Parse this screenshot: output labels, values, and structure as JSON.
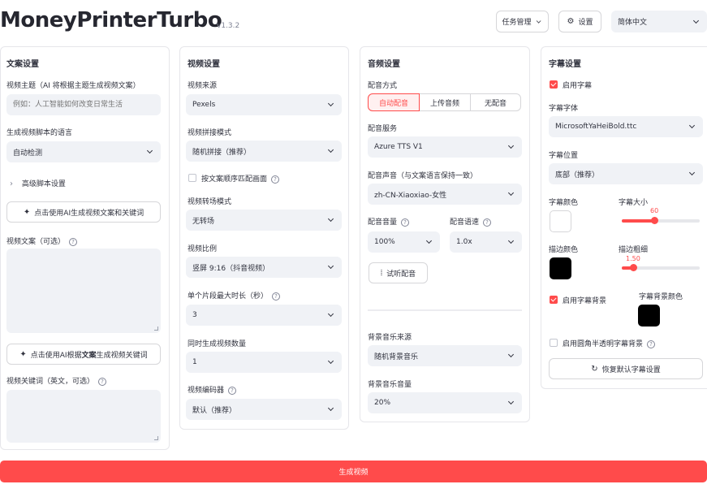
{
  "header": {
    "title": "MoneyPrinterTurbo",
    "version": "v1.3.2",
    "task_mgmt_label": "任务管理",
    "settings_label": "设置",
    "language_value": "简体中文"
  },
  "script_panel": {
    "title": "文案设置",
    "subject_label": "视频主题（AI 将根据主题生成视频文案）",
    "subject_placeholder": "例如：人工智能如何改变日常生活",
    "language_label": "生成视频脚本的语言",
    "language_value": "自动检测",
    "advanced_label": "高级脚本设置",
    "gen_script_btn": "点击使用AI生成视频文案和关键词",
    "script_label": "视频文案（可选）",
    "gen_keywords_btn_pre": "点击使用AI根据",
    "gen_keywords_btn_bold": "文案",
    "gen_keywords_btn_post": "生成视频关键词",
    "keywords_label": "视频关键词（英文，可选）"
  },
  "video_panel": {
    "title": "视频设置",
    "source_label": "视频来源",
    "source_value": "Pexels",
    "concat_label": "视频拼接模式",
    "concat_value": "随机拼接（推荐）",
    "match_label": "按文案顺序匹配画面",
    "transition_label": "视频转场模式",
    "transition_value": "无转场",
    "aspect_label": "视频比例",
    "aspect_value": "竖屏 9:16（抖音视频）",
    "clip_len_label": "单个片段最大时长（秒）",
    "clip_len_value": "3",
    "count_label": "同时生成视频数量",
    "count_value": "1",
    "codec_label": "视频编码器",
    "codec_value": "默认（推荐）"
  },
  "audio_panel": {
    "title": "音频设置",
    "mode_label": "配音方式",
    "mode_options": [
      "自动配音",
      "上传音频",
      "无配音"
    ],
    "service_label": "配音服务",
    "service_value": "Azure TTS V1",
    "voice_label": "配音声音（与文案语言保持一致）",
    "voice_value": "zh-CN-Xiaoxiao-女性",
    "volume_label": "配音音量",
    "volume_value": "100%",
    "rate_label": "配音语速",
    "rate_value": "1.0x",
    "listen_btn": "试听配音",
    "bgm_source_label": "背景音乐来源",
    "bgm_source_value": "随机背景音乐",
    "bgm_volume_label": "背景音乐音量",
    "bgm_volume_value": "20%"
  },
  "subtitle_panel": {
    "title": "字幕设置",
    "enable_label": "启用字幕",
    "font_label": "字幕字体",
    "font_value": "MicrosoftYaHeiBold.ttc",
    "position_label": "字幕位置",
    "position_value": "底部（推荐）",
    "color_label": "字幕颜色",
    "size_label": "字幕大小",
    "size_value": "60",
    "stroke_color_label": "描边颜色",
    "stroke_width_label": "描边粗细",
    "stroke_width_value": "1.50",
    "bg_enable_label": "启用字幕背景",
    "bg_color_label": "字幕背景颜色",
    "rounded_label": "启用圆角半透明字幕背景",
    "reset_btn": "恢复默认字幕设置",
    "colors": {
      "font": "#ffffff",
      "stroke": "#000000",
      "background": "#000000"
    }
  },
  "generate_btn": "生成视频",
  "accent": "#ff4b4b"
}
